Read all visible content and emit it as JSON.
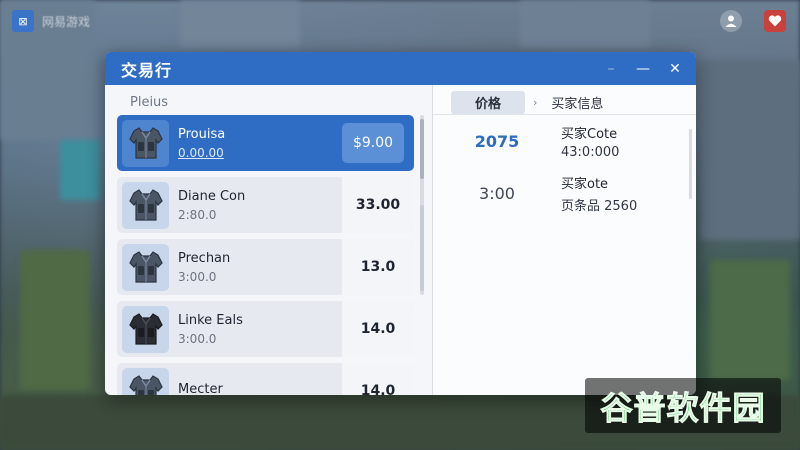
{
  "hud": {
    "top_left_label": "网易游戏",
    "logo_glyph": "⊠",
    "user_icon": "user-icon",
    "heart_icon": "heart-icon"
  },
  "window": {
    "title": "交易行",
    "accent_color": "#2f6cc4",
    "controls": {
      "minimize_glyph": "—",
      "close_glyph": "✕",
      "extra_glyph": "–"
    }
  },
  "list": {
    "header": "Pleius",
    "items": [
      {
        "name": "Prouisa",
        "sub": "0.00.00",
        "price": "$9.00",
        "selected": true,
        "icon": "armor-vest-icon"
      },
      {
        "name": "Diane Con",
        "sub": "2:80.0",
        "price": "33.00",
        "selected": false,
        "icon": "armor-vest-icon"
      },
      {
        "name": "Prechan",
        "sub": "3:00.0",
        "price": "13.0",
        "selected": false,
        "icon": "armor-vest-icon"
      },
      {
        "name": "Linke Eals",
        "sub": "3:00.0",
        "price": "14.0",
        "selected": false,
        "icon": "black-armor-vest-icon"
      },
      {
        "name": "Mecter",
        "sub": "",
        "price": "14.0",
        "selected": false,
        "icon": "armor-vest-icon"
      }
    ]
  },
  "tabs": {
    "price": "价格",
    "separator": "›",
    "seller_info": "买家信息"
  },
  "offers": [
    {
      "price": "2075",
      "seller": "买家Cote",
      "detail": "43:0:000",
      "highlight": true
    },
    {
      "price": "3:00",
      "seller": "买家ote",
      "detail": "页条品 2560",
      "highlight": false
    }
  ],
  "watermark": {
    "text": "谷普软件园"
  }
}
